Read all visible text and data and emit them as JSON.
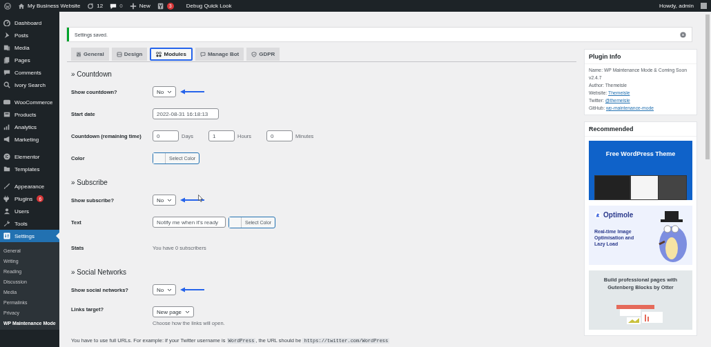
{
  "admin_bar": {
    "site": "My Business Website",
    "updates": "12",
    "comments": "0",
    "new": "New",
    "seo_badge": "3",
    "debug": "Debug Quick Look",
    "greeting": "Howdy, admin"
  },
  "menu_groups": [
    [
      {
        "label": "Dashboard",
        "selected": false
      },
      {
        "label": "Posts",
        "selected": false
      },
      {
        "label": "Media",
        "selected": false
      },
      {
        "label": "Pages",
        "selected": false
      },
      {
        "label": "Comments",
        "selected": false
      },
      {
        "label": "Ivory Search",
        "selected": false
      }
    ],
    [
      {
        "label": "WooCommerce",
        "selected": false
      },
      {
        "label": "Products",
        "selected": false
      },
      {
        "label": "Analytics",
        "selected": false
      },
      {
        "label": "Marketing",
        "selected": false
      }
    ],
    [
      {
        "label": "Elementor",
        "selected": false
      },
      {
        "label": "Templates",
        "selected": false
      }
    ],
    [
      {
        "label": "Appearance",
        "selected": false
      },
      {
        "label": "Plugins",
        "selected": false,
        "badge": "6"
      },
      {
        "label": "Users",
        "selected": false
      },
      {
        "label": "Tools",
        "selected": false
      },
      {
        "label": "Settings",
        "selected": true,
        "submenu": [
          {
            "label": "General",
            "selected": false
          },
          {
            "label": "Writing",
            "selected": false
          },
          {
            "label": "Reading",
            "selected": false
          },
          {
            "label": "Discussion",
            "selected": false
          },
          {
            "label": "Media",
            "selected": false
          },
          {
            "label": "Permalinks",
            "selected": false
          },
          {
            "label": "Privacy",
            "selected": false
          },
          {
            "label": "WP Maintenance Mode",
            "selected": true
          }
        ]
      }
    ]
  ],
  "notice": {
    "text": "Settings saved."
  },
  "tabs": [
    {
      "label": "General",
      "selected": false
    },
    {
      "label": "Design",
      "selected": false
    },
    {
      "label": "Modules",
      "selected": true
    },
    {
      "label": "Manage Bot",
      "selected": false
    },
    {
      "label": "GDPR",
      "selected": false
    }
  ],
  "sections": [
    {
      "title": "» Countdown",
      "rows": [
        {
          "kind": "select",
          "label": "Show countdown?",
          "value": "No",
          "arrow": true
        },
        {
          "kind": "text",
          "label": "Start date",
          "value": "2022-08-31 16:18:13"
        },
        {
          "kind": "duration",
          "label": "Countdown (remaining time)",
          "parts": [
            {
              "value": "0",
              "unit": "Days"
            },
            {
              "value": "1",
              "unit": "Hours"
            },
            {
              "value": "0",
              "unit": "Minutes"
            }
          ]
        },
        {
          "kind": "color",
          "label": "Color",
          "button": "Select Color"
        }
      ]
    },
    {
      "title": "» Subscribe",
      "rows": [
        {
          "kind": "select",
          "label": "Show subscribe?",
          "value": "No",
          "arrow": true
        },
        {
          "kind": "text_color",
          "label": "Text",
          "value": "Notify me when it's ready",
          "button": "Select Color"
        },
        {
          "kind": "static",
          "label": "Stats",
          "text": "You have 0 subscribers"
        }
      ]
    },
    {
      "title": "» Social Networks",
      "rows": [
        {
          "kind": "select",
          "label": "Show social networks?",
          "value": "No",
          "arrow": true
        },
        {
          "kind": "select",
          "label": "Links target?",
          "value": "New page",
          "arrow": false,
          "help": "Choose how the links will open."
        }
      ]
    }
  ],
  "footer_note": [
    {
      "kind": "text",
      "text": "You have to use full URLs. For example: if your Twitter username is "
    },
    {
      "kind": "code",
      "text": "WordPress"
    },
    {
      "kind": "text",
      "text": ", the URL should be "
    },
    {
      "kind": "code",
      "text": "https://twitter.com/WordPress"
    }
  ],
  "plugin_info": {
    "title": "Plugin Info",
    "lines": [
      {
        "label": "Name:",
        "value": "WP Maintenance Mode & Coming Soon v2.4.7",
        "link": false
      },
      {
        "label": "Author:",
        "value": "Themeisle",
        "link": false
      },
      {
        "label": "Website:",
        "value": "Themeisle",
        "link": true
      },
      {
        "label": "Twitter:",
        "value": "@themeisle",
        "link": true
      },
      {
        "label": "GitHub:",
        "value": "wp-maintenance-mode",
        "link": true
      }
    ]
  },
  "recommended": {
    "title": "Recommended",
    "banners": [
      {
        "kind": "theme",
        "title": "Free WordPress Theme"
      },
      {
        "kind": "optimole",
        "title": "Optimole",
        "text": "Real-time Image Optimisation and Lazy Load"
      },
      {
        "kind": "otter",
        "title": "Build professional pages with Gutenberg Blocks by Otter"
      }
    ]
  }
}
